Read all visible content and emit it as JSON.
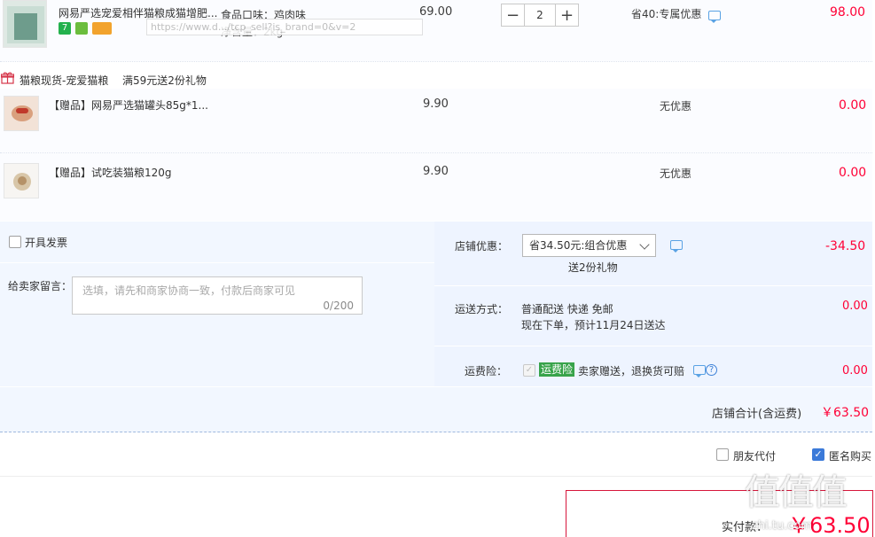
{
  "item_main": {
    "title": "网易严选宠爱相伴猫粮成猫增肥...",
    "spec_flavor": "食品口味：鸡肉味",
    "spec_weight": "净含量：2kg",
    "tooltip_url": "https://www.d.../tcp_sell?is_brand=0&v=2",
    "price": "69.00",
    "quantity": "2",
    "discount": "省40:专属优惠",
    "total": "98.00",
    "badge_colors": [
      "#23b14d",
      "#6bbd3d",
      "#f2a32d"
    ]
  },
  "gift_promo": {
    "label": "猫粮现货-宠爱猫粮",
    "rule": "满59元送2份礼物"
  },
  "gifts": [
    {
      "title": "【赠品】网易严选猫罐头85g*1...",
      "price": "9.90",
      "discount": "无优惠",
      "total": "0.00"
    },
    {
      "title": "【赠品】试吃装猫粮120g",
      "price": "9.90",
      "discount": "无优惠",
      "total": "0.00"
    }
  ],
  "invoice": {
    "label": "开具发票"
  },
  "message": {
    "label": "给卖家留言：",
    "placeholder": "选填，请先和商家协商一致，付款后商家可见",
    "counter": "0/200"
  },
  "shop_discount": {
    "label": "店铺优惠：",
    "selected": "省34.50元:组合优惠",
    "sub": "送2份礼物",
    "amount": "-34.50"
  },
  "delivery": {
    "label": "运送方式：",
    "method": "普通配送 快递 免邮",
    "eta": "现在下单，预计11月24日送达",
    "amount": "0.00"
  },
  "shipping_insurance": {
    "label": "运费险：",
    "tag": "运费险",
    "desc": "卖家赠送，退换货可赔",
    "amount": "0.00"
  },
  "shop_total": {
    "label": "店铺合计(含运费)",
    "amount": "￥63.50"
  },
  "options": {
    "friend_pay": "朋友代付",
    "anonymous": "匿名购买"
  },
  "payment": {
    "label": "实付款：",
    "amount": "￥63.50"
  },
  "watermark": {
    "logo": "值值值",
    "site": "zhi.tu.com"
  },
  "colors": {
    "price_red": "#ff0036",
    "accent_blue": "#3b7ad9",
    "pay_border": "#d7163b"
  }
}
